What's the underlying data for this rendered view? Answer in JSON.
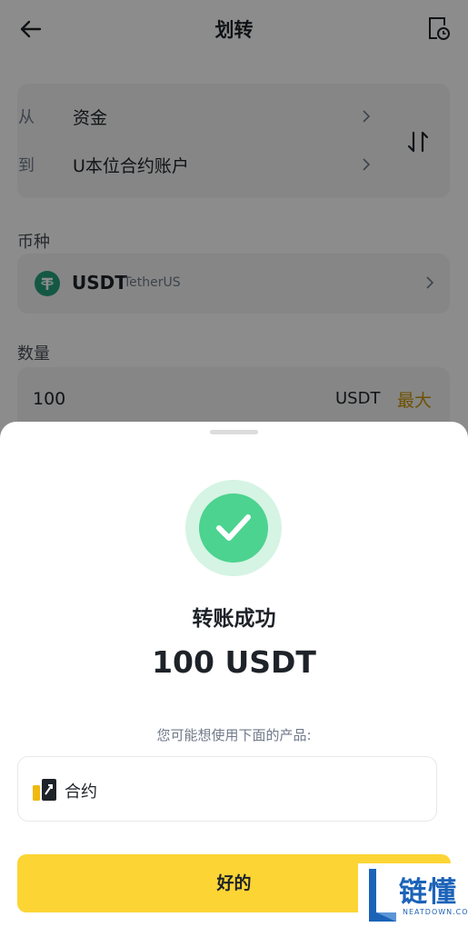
{
  "header": {
    "title": "划转",
    "back_icon": "arrow-left-icon",
    "history_icon": "history-icon"
  },
  "transfer": {
    "from_key": "从",
    "from_value": "资金",
    "to_key": "到",
    "to_value": "U本位合约账户",
    "swap_icon": "swap-vertical-icon"
  },
  "coin": {
    "label": "币种",
    "symbol": "USDT",
    "name": "TetherUS"
  },
  "amount": {
    "label": "数量",
    "value": "100",
    "unit": "USDT",
    "max_label": "最大"
  },
  "sheet": {
    "success_text": "转账成功",
    "success_amount": "100 USDT",
    "suggest_text": "您可能想使用下面的产品:",
    "product_label": "合约",
    "ok_label": "好的"
  },
  "watermark": {
    "text": "链懂",
    "sub": "NEATDOWN.COM"
  },
  "colors": {
    "accent": "#fcd535",
    "success": "#4cd38f",
    "max": "#c99400",
    "tether": "#26a17b"
  }
}
